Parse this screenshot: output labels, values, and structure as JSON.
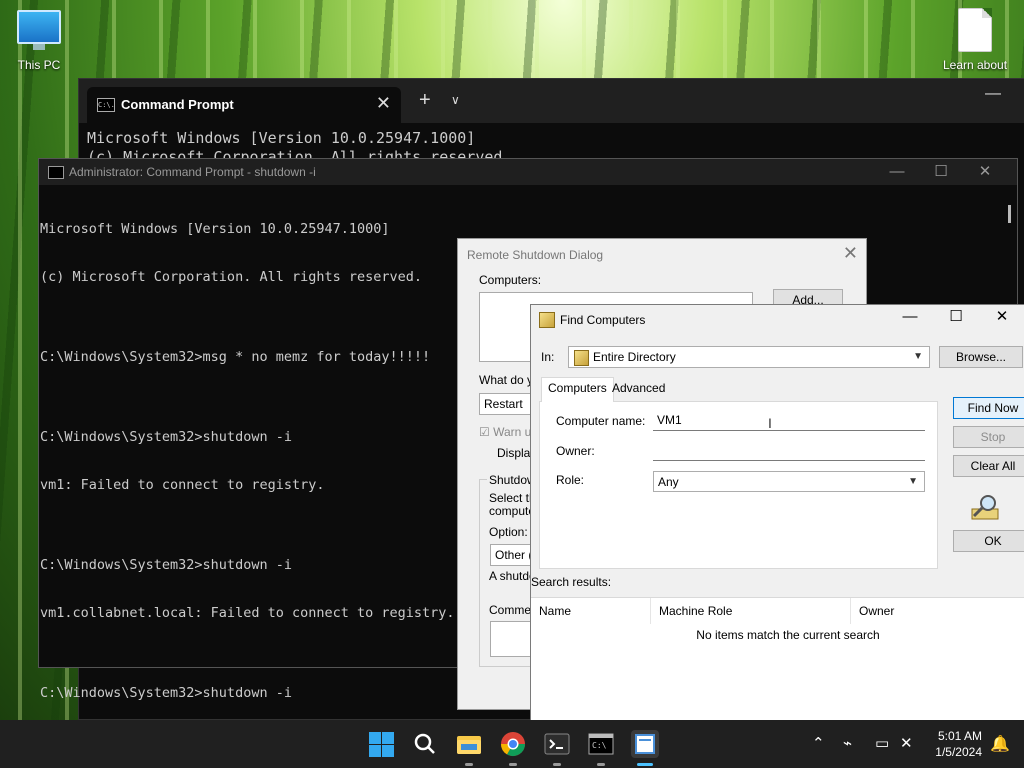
{
  "desktop": {
    "icons": [
      {
        "label": "This PC",
        "icon": "monitor-icon"
      },
      {
        "label": "Learn about",
        "icon": "document-icon"
      }
    ]
  },
  "terminal": {
    "tab_title": "Command Prompt",
    "tab_icon": "C:\\.",
    "lines": [
      "Microsoft Windows [Version 10.0.25947.1000]",
      "(c) Microsoft Corporation. All rights reserved."
    ]
  },
  "admin_cmd": {
    "title": "Administrator: Command Prompt - shutdown  -i",
    "lines": [
      "Microsoft Windows [Version 10.0.25947.1000]",
      "(c) Microsoft Corporation. All rights reserved.",
      "",
      "C:\\Windows\\System32>msg * no memz for today!!!!!",
      "",
      "C:\\Windows\\System32>shutdown -i",
      "vm1: Failed to connect to registry.",
      "",
      "C:\\Windows\\System32>shutdown -i",
      "vm1.collabnet.local: Failed to connect to registry.",
      "",
      "C:\\Windows\\System32>shutdown -i"
    ]
  },
  "remote_shutdown": {
    "title": "Remote Shutdown Dialog",
    "computers_label": "Computers:",
    "add_button": "Add...",
    "what_label": "What do y",
    "action_value": "Restart",
    "warn_label": "Warn u",
    "display_label": "Displa",
    "group_label": "Shutdow",
    "select_text_1": "Select th",
    "select_text_2": "compute",
    "option_label": "Option:",
    "option_value": "Other (P",
    "shutdown_text": "A shutdo",
    "comment_label": "Commen"
  },
  "find_computers": {
    "title": "Find Computers",
    "in_label": "In:",
    "in_value": "Entire Directory",
    "browse_button": "Browse...",
    "tabs": [
      "Computers",
      "Advanced"
    ],
    "computer_name_label": "Computer name:",
    "computer_name_value": "VM1",
    "owner_label": "Owner:",
    "owner_value": "",
    "role_label": "Role:",
    "role_value": "Any",
    "buttons": {
      "find_now": "Find Now",
      "stop": "Stop",
      "clear_all": "Clear All",
      "ok": "OK"
    },
    "search_results_label": "Search results:",
    "columns": [
      "Name",
      "Machine Role",
      "Owner"
    ],
    "empty_message": "No items match the current search"
  },
  "taskbar": {
    "time": "5:01 AM",
    "date": "1/5/2024",
    "apps": [
      "start-icon",
      "search-icon",
      "file-explorer-icon",
      "chrome-icon",
      "terminal-icon",
      "command-prompt-icon",
      "remote-shutdown-icon"
    ]
  },
  "colors": {
    "accent": "#0078d4",
    "taskbar": "#202020",
    "console_bg": "#0c0c0c",
    "console_text": "#cccccc"
  }
}
